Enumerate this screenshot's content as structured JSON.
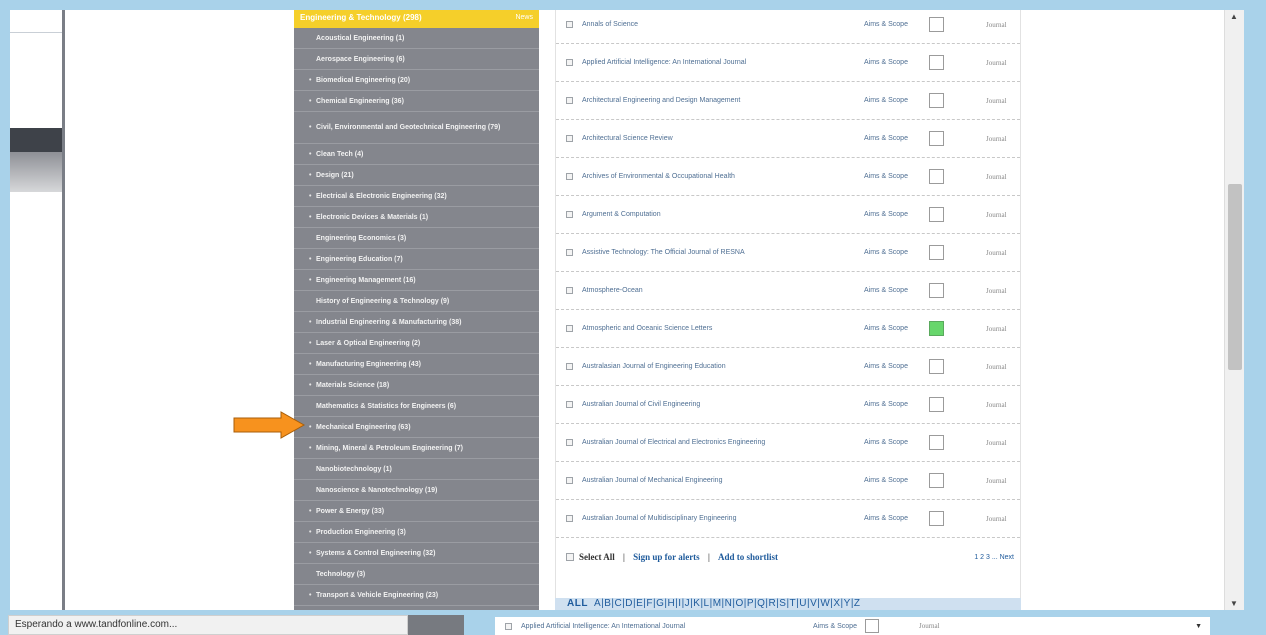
{
  "sidebar": {
    "header": "Engineering & Technology (298)",
    "news": "News",
    "items": [
      {
        "label": "Acoustical Engineering (1)",
        "bullet": false
      },
      {
        "label": "Aerospace Engineering (6)",
        "bullet": false
      },
      {
        "label": "Biomedical Engineering (20)",
        "bullet": true
      },
      {
        "label": "Chemical Engineering (36)",
        "bullet": true
      },
      {
        "label": "Civil, Environmental and Geotechnical Engineering (79)",
        "bullet": true
      },
      {
        "label": "Clean Tech (4)",
        "bullet": true
      },
      {
        "label": "Design (21)",
        "bullet": true
      },
      {
        "label": "Electrical & Electronic Engineering (32)",
        "bullet": true
      },
      {
        "label": "Electronic Devices & Materials (1)",
        "bullet": true
      },
      {
        "label": "Engineering Economics (3)",
        "bullet": false
      },
      {
        "label": "Engineering Education (7)",
        "bullet": true
      },
      {
        "label": "Engineering Management (16)",
        "bullet": true
      },
      {
        "label": "History of Engineering & Technology (9)",
        "bullet": false
      },
      {
        "label": "Industrial Engineering & Manufacturing (38)",
        "bullet": true
      },
      {
        "label": "Laser & Optical Engineering (2)",
        "bullet": true
      },
      {
        "label": "Manufacturing Engineering (43)",
        "bullet": true
      },
      {
        "label": "Materials Science (18)",
        "bullet": true
      },
      {
        "label": "Mathematics & Statistics for Engineers (6)",
        "bullet": false
      },
      {
        "label": "Mechanical Engineering (63)",
        "bullet": true
      },
      {
        "label": "Mining, Mineral & Petroleum Engineering (7)",
        "bullet": true
      },
      {
        "label": "Nanobiotechnology (1)",
        "bullet": false
      },
      {
        "label": "Nanoscience & Nanotechnology (19)",
        "bullet": false
      },
      {
        "label": "Power & Energy (33)",
        "bullet": true
      },
      {
        "label": "Production Engineering (3)",
        "bullet": true
      },
      {
        "label": "Systems & Control Engineering (32)",
        "bullet": true
      },
      {
        "label": "Technology (3)",
        "bullet": false
      },
      {
        "label": "Transport & Vehicle Engineering (23)",
        "bullet": true
      }
    ]
  },
  "journals": [
    {
      "title": "Annals of Science",
      "aims": "Aims & Scope",
      "checked": false,
      "type": "Journal"
    },
    {
      "title": "Applied Artificial Intelligence: An International Journal",
      "aims": "Aims & Scope",
      "checked": false,
      "type": "Journal"
    },
    {
      "title": "Architectural Engineering and Design Management",
      "aims": "Aims & Scope",
      "checked": false,
      "type": "Journal"
    },
    {
      "title": "Architectural Science Review",
      "aims": "Aims & Scope",
      "checked": false,
      "type": "Journal"
    },
    {
      "title": "Archives of Environmental & Occupational Health",
      "aims": "Aims & Scope",
      "checked": false,
      "type": "Journal"
    },
    {
      "title": "Argument & Computation",
      "aims": "Aims & Scope",
      "checked": false,
      "type": "Journal"
    },
    {
      "title": "Assistive Technology: The Official Journal of RESNA",
      "aims": "Aims & Scope",
      "checked": false,
      "type": "Journal"
    },
    {
      "title": "Atmosphere-Ocean",
      "aims": "Aims & Scope",
      "checked": false,
      "type": "Journal"
    },
    {
      "title": "Atmospheric and Oceanic Science Letters",
      "aims": "Aims & Scope",
      "checked": true,
      "type": "Journal"
    },
    {
      "title": "Australasian Journal of Engineering Education",
      "aims": "Aims & Scope",
      "checked": false,
      "type": "Journal"
    },
    {
      "title": "Australian Journal of Civil Engineering",
      "aims": "Aims & Scope",
      "checked": false,
      "type": "Journal"
    },
    {
      "title": "Australian Journal of Electrical and Electronics Engineering",
      "aims": "Aims & Scope",
      "checked": false,
      "type": "Journal"
    },
    {
      "title": "Australian Journal of Mechanical Engineering",
      "aims": "Aims & Scope",
      "checked": false,
      "type": "Journal"
    },
    {
      "title": "Australian Journal of Multidisciplinary Engineering",
      "aims": "Aims & Scope",
      "checked": false,
      "type": "Journal"
    }
  ],
  "footer": {
    "select_all": "Select All",
    "sep": "|",
    "alerts": "Sign up for alerts",
    "shortlist": "Add to shortlist",
    "pages": "1  2  3  ...  Next"
  },
  "alpha": {
    "all": "ALL",
    "letters": "A|B|C|D|E|F|G|H|I|J|K|L|M|N|O|P|Q|R|S|T|U|V|W|X|Y|Z"
  },
  "status": {
    "text": "Esperando a www.tandfonline.com...",
    "row_title": "Applied Artificial Intelligence: An International Journal",
    "row_aims": "Aims & Scope",
    "row_type": "Journal"
  },
  "colors": {
    "sidebar_bg": "#84868d",
    "header_bg": "#f5cf2a",
    "arrow": "#f7921e",
    "checked_green": "#67d66b"
  }
}
